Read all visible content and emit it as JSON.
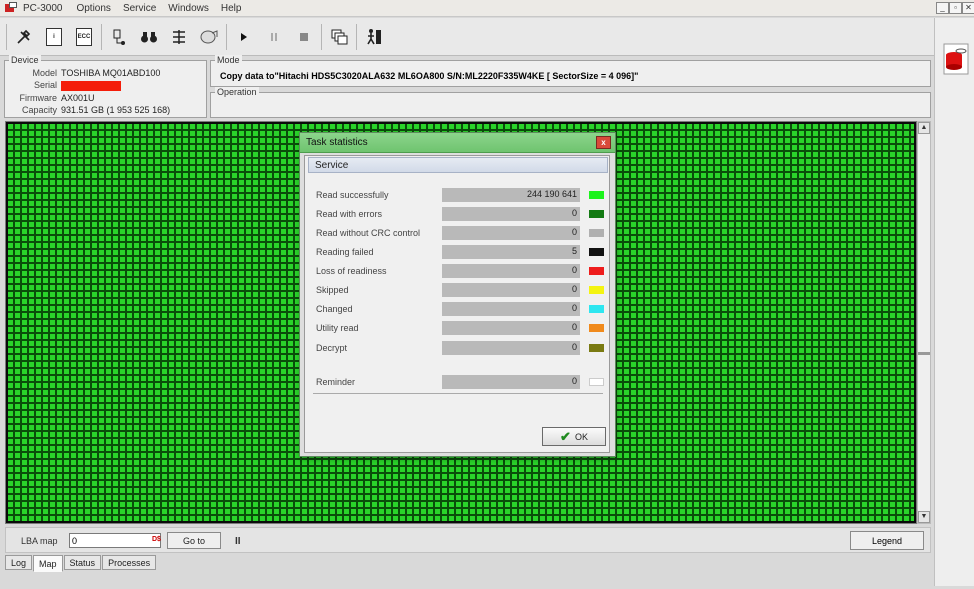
{
  "app": {
    "title": "PC-3000"
  },
  "menu": [
    "Options",
    "Service",
    "Windows",
    "Help"
  ],
  "window_controls": {
    "minimize": "_",
    "restore": "▫",
    "close": "✕"
  },
  "device": {
    "group_label": "Device",
    "model_label": "Model",
    "model": "TOSHIBA MQ01ABD100",
    "serial_label": "Serial",
    "firmware_label": "Firmware",
    "firmware": "AX001U",
    "capacity_label": "Capacity",
    "capacity": "931.51 GB (1 953 525 168)"
  },
  "mode": {
    "group_label": "Mode",
    "text": "Copy data to\"Hitachi HDS5C3020ALA632 ML6OA800 S/N:ML2220F335W4KE [ SectorSize = 4 096]\""
  },
  "operation": {
    "group_label": "Operation"
  },
  "bottom": {
    "lba_label": "LBA map",
    "lba_value": "0",
    "dec_tag": "D$",
    "goto_label": "Go to",
    "pause": "II",
    "legend_label": "Legend"
  },
  "tabs": [
    "Log",
    "Map",
    "Status",
    "Processes"
  ],
  "active_tab": "Map",
  "dialog": {
    "title": "Task statistics",
    "close": "x",
    "section": "Service",
    "rows": [
      {
        "label": "Read successfully",
        "value": "244 190 641",
        "color": "#1cf31c"
      },
      {
        "label": "Read with errors",
        "value": "0",
        "color": "#137a13"
      },
      {
        "label": "Read without CRC control",
        "value": "0",
        "color": "#b0b0b0"
      },
      {
        "label": "Reading failed",
        "value": "5",
        "color": "#111111"
      },
      {
        "label": "Loss of readiness",
        "value": "0",
        "color": "#ee1c1c"
      },
      {
        "label": "Skipped",
        "value": "0",
        "color": "#f4f410"
      },
      {
        "label": "Changed",
        "value": "0",
        "color": "#2ee6f0"
      },
      {
        "label": "Utility read",
        "value": "0",
        "color": "#f08a1c"
      },
      {
        "label": "Decrypt",
        "value": "0",
        "color": "#7a7a12"
      }
    ],
    "reminder": {
      "label": "Reminder",
      "value": "0",
      "color": "#ffffff"
    },
    "ok_label": "OK"
  },
  "icons": {
    "toolbar": [
      "tools-icon",
      "info-icon",
      "ecc-icon",
      "head-map-icon",
      "binoculars-icon",
      "task-icon",
      "drive-icon",
      "play-icon",
      "pause-icon",
      "stop-icon",
      "windows-icon",
      "exit-icon"
    ]
  }
}
